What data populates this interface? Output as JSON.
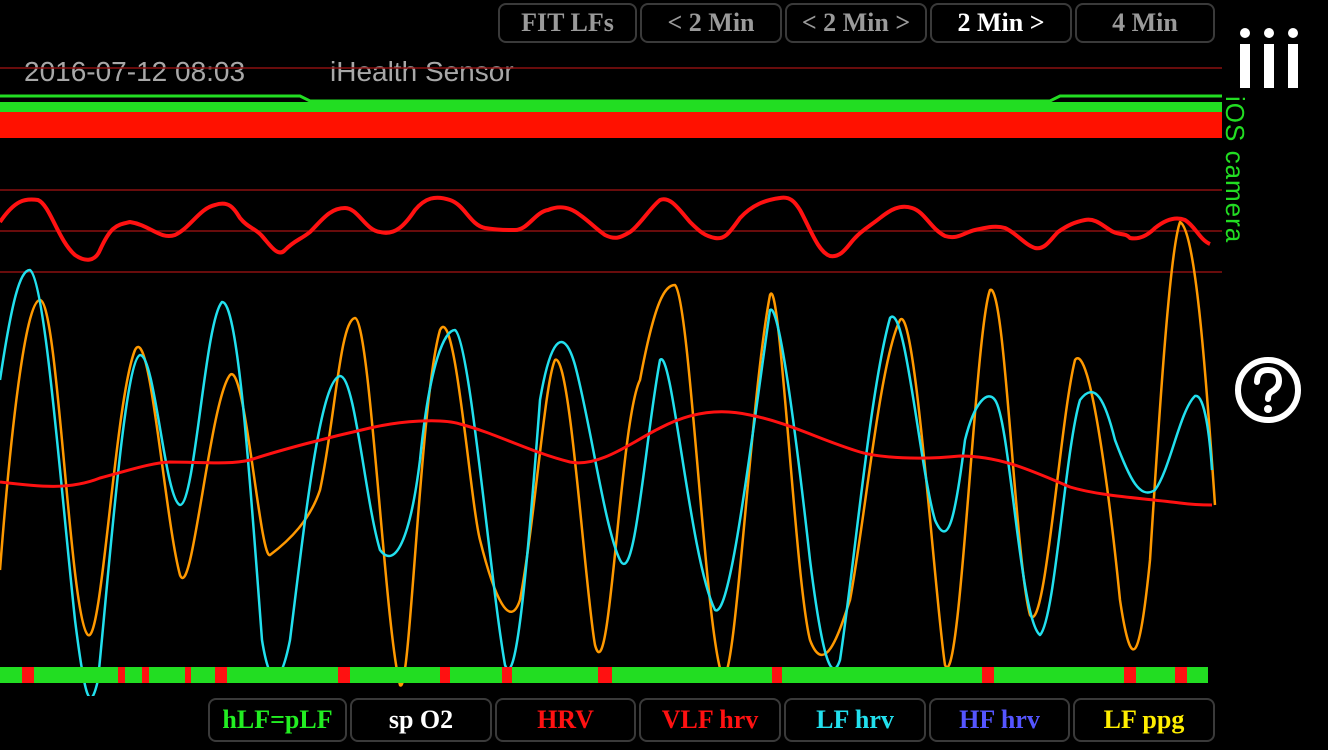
{
  "header": {
    "datetime": "2016-07-12 08:03",
    "sensor": "iHealth Sensor",
    "camera_label": "iOS camera"
  },
  "top_buttons": [
    {
      "label": "FIT LFs",
      "active": false
    },
    {
      "label": "< 2 Min",
      "active": false
    },
    {
      "label": "< 2 Min >",
      "active": false
    },
    {
      "label": "2 Min >",
      "active": true
    },
    {
      "label": "4 Min",
      "active": false
    }
  ],
  "legend_buttons": [
    {
      "label": "hLF=pLF",
      "color": "#22ee22"
    },
    {
      "label": "sp O2",
      "color": "#ffffff"
    },
    {
      "label": "HRV",
      "color": "#ff1111"
    },
    {
      "label": "VLF hrv",
      "color": "#ff1111"
    },
    {
      "label": "LF hrv",
      "color": "#22e0ee"
    },
    {
      "label": "HF hrv",
      "color": "#5555ff"
    },
    {
      "label": "LF ppg",
      "color": "#ffee00"
    }
  ],
  "icons": {
    "info": "info-bars-icon",
    "help": "question-circle-icon"
  },
  "colors": {
    "background": "#000000",
    "green": "#22dd22",
    "red": "#ff1100",
    "cyan": "#22e0ee",
    "orange": "#ff9900",
    "gridline": "#8b1010"
  }
}
